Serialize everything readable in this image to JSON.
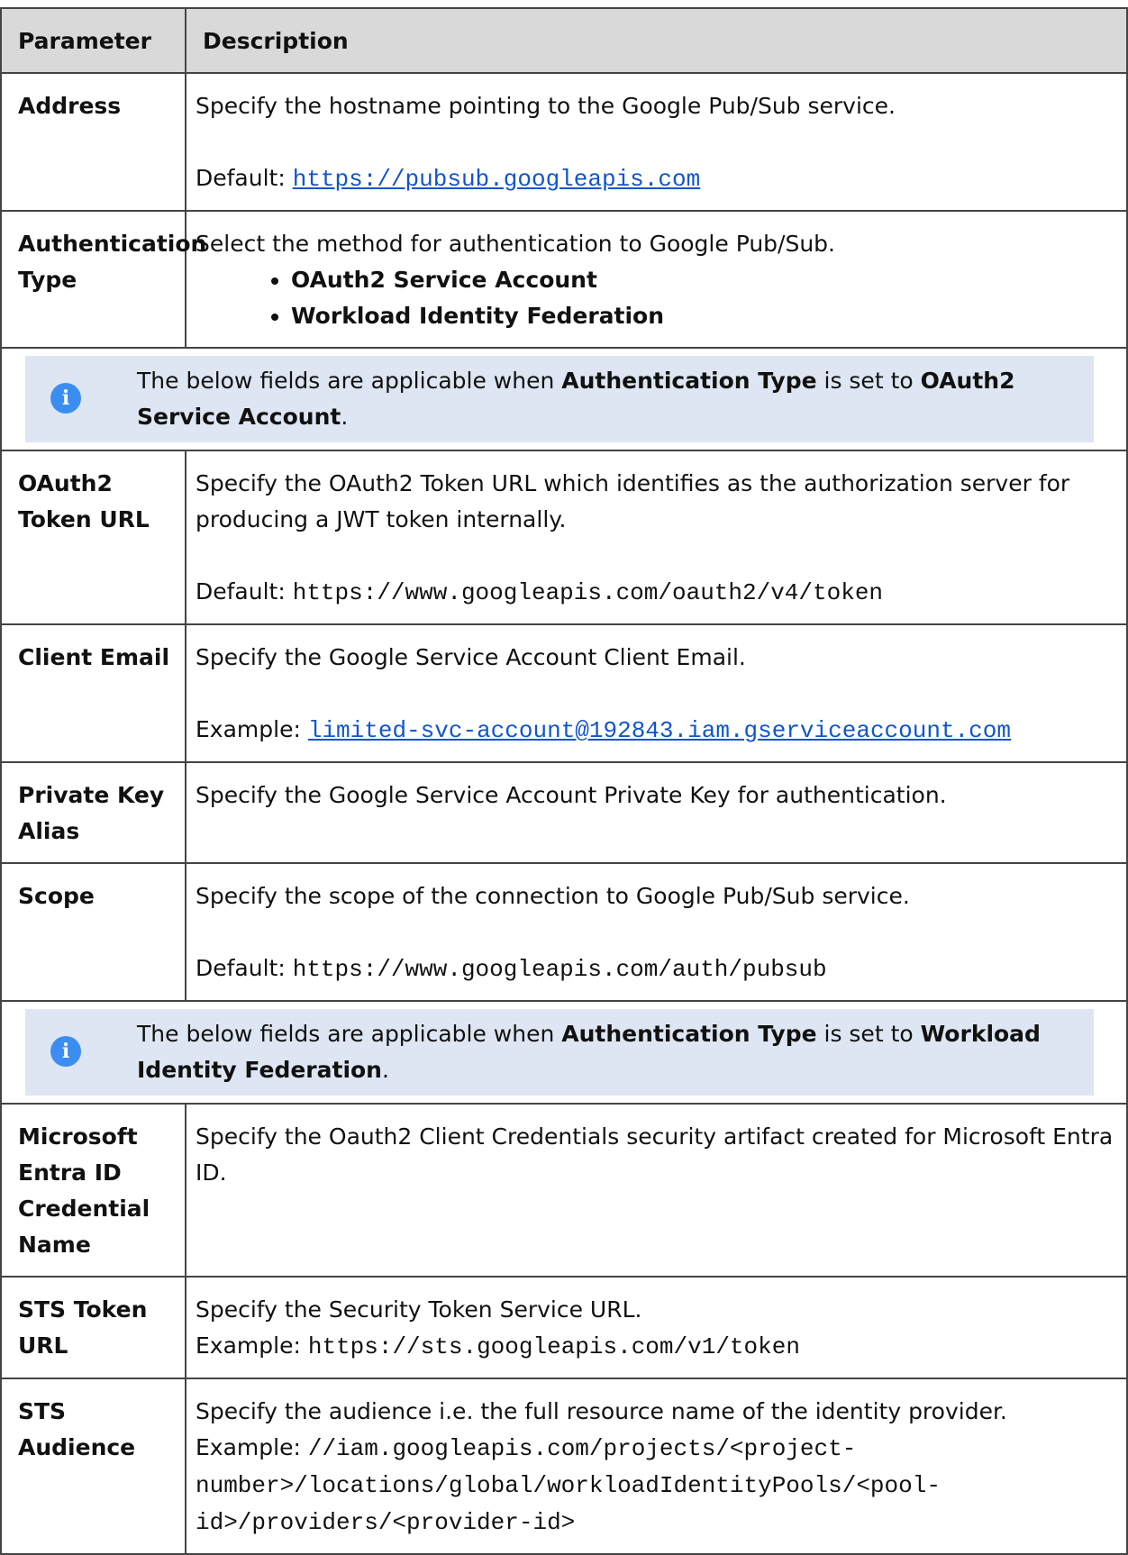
{
  "header": {
    "parameter": "Parameter",
    "description": "Description"
  },
  "rows": {
    "address": {
      "name": "Address",
      "desc": "Specify the hostname pointing to the Google Pub/Sub service.",
      "default_label": "Default: ",
      "default_value": "https://pubsub.googleapis.com"
    },
    "auth_type": {
      "name": "Authentication Type",
      "desc": "Select the method for authentication to Google Pub/Sub.",
      "options": [
        "OAuth2 Service Account",
        "Workload Identity Federation"
      ]
    },
    "note_oauth": {
      "pre": "The below fields are applicable when ",
      "bold1": "Authentication Type",
      "mid": " is set to ",
      "bold2": "OAuth2 Service Account",
      "end": "."
    },
    "oauth_token_url": {
      "name": "OAuth2 Token URL",
      "desc": "Specify the OAuth2 Token URL which identifies as the authorization server for producing a JWT token internally.",
      "default_label": "Default: ",
      "default_value": "https://www.googleapis.com/oauth2/v4/token"
    },
    "client_email": {
      "name": "Client Email",
      "desc": "Specify the Google Service Account Client Email.",
      "example_label": "Example: ",
      "example_value": "limited-svc-account@192843.iam.gserviceaccount.com"
    },
    "private_key_alias": {
      "name": "Private Key Alias",
      "desc": "Specify the Google Service Account Private Key for authentication."
    },
    "scope": {
      "name": "Scope",
      "desc": "Specify the scope of the connection to Google Pub/Sub service.",
      "default_label": "Default: ",
      "default_value": "https://www.googleapis.com/auth/pubsub"
    },
    "note_wif": {
      "pre": "The below fields are applicable when ",
      "bold1": "Authentication Type",
      "mid": " is set to ",
      "bold2": "Workload Identity Federation",
      "end": "."
    },
    "entra_credential": {
      "name": "Microsoft Entra ID Credential Name",
      "desc": "Specify the Oauth2 Client Credentials security artifact created for Microsoft Entra ID."
    },
    "sts_token_url": {
      "name": "STS Token URL",
      "desc": "Specify the Security Token Service URL.",
      "example_label": "Example: ",
      "example_value": "https://sts.googleapis.com/v1/token"
    },
    "sts_audience": {
      "name": "STS Audience",
      "desc": "Specify the audience i.e. the full resource name of the identity provider.",
      "example_label": "Example: ",
      "example_value": "//iam.googleapis.com/projects/<project-number>/locations/global/workloadIdentityPools/<pool-id>/providers/<provider-id>"
    }
  },
  "icons": {
    "info": "info-icon",
    "info_glyph": "i",
    "info_color": "#3b8ef0"
  },
  "colors": {
    "header_bg": "#d9d9d9",
    "note_bg": "#dde6f2",
    "link": "#1155cc"
  }
}
